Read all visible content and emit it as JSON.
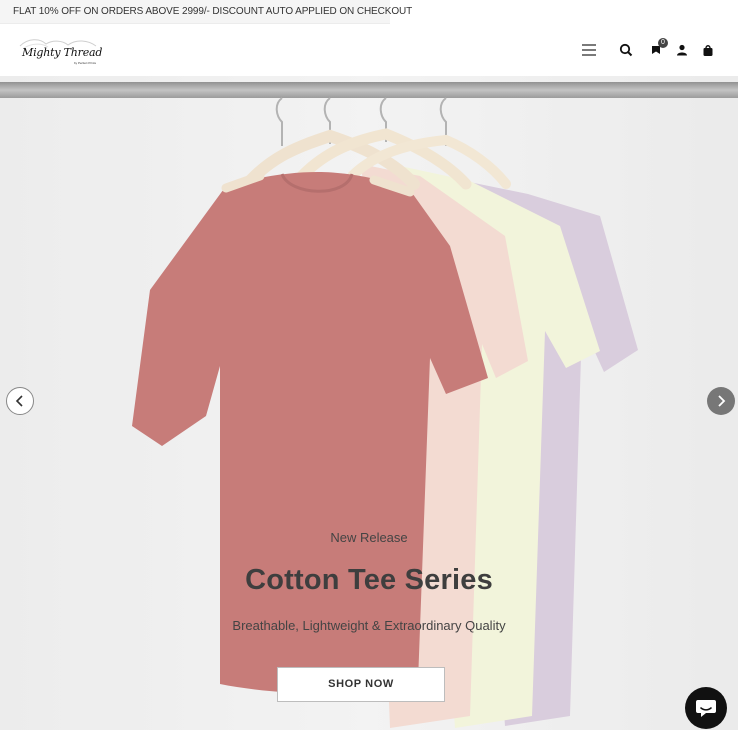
{
  "announcement": {
    "text": "FLAT 10% OFF ON ORDERS ABOVE 2999/- DISCOUNT AUTO APPLIED ON CHECKOUT"
  },
  "header": {
    "logo_text": "Mighty Thread",
    "logo_sub": "by Perfect Prints",
    "icons": [
      "menu-icon",
      "search-icon",
      "wishlist-icon",
      "account-icon",
      "cart-icon"
    ],
    "wishlist_count": "0"
  },
  "hero": {
    "eyebrow": "New Release",
    "title": "Cotton Tee Series",
    "subtitle": "Breathable, Lightweight & Extraordinary Quality",
    "cta": "SHOP NOW",
    "colors": {
      "tshirt_red": "#b5504d",
      "tshirt_peach": "#efcfc3",
      "tshirt_cream": "#eef0cf",
      "tshirt_lilac": "#cdbcd2",
      "background": "#ececec"
    }
  },
  "carousel": {
    "prev_icon": "chevron-left-icon",
    "next_icon": "chevron-right-icon"
  },
  "chat": {
    "icon": "chat-bubble-icon"
  }
}
